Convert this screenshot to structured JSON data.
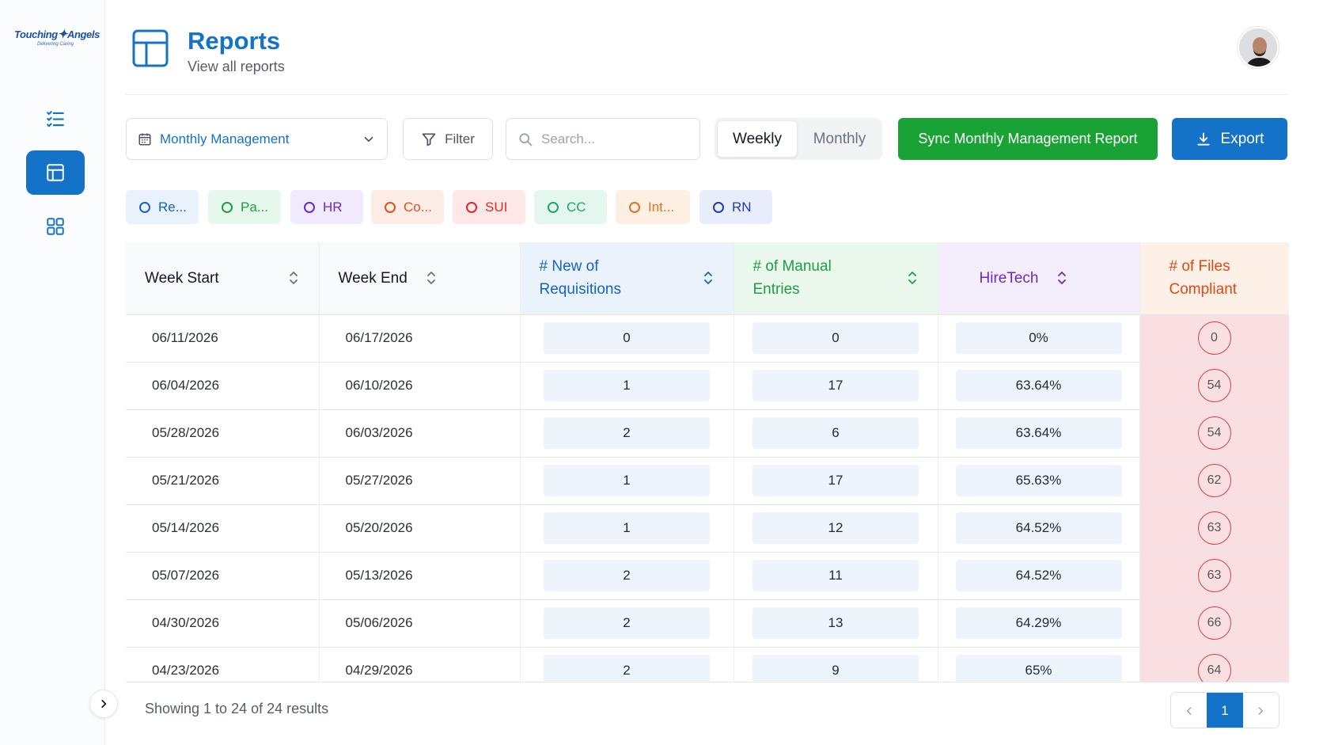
{
  "brand": {
    "logo_text": "Touching Angels",
    "logo_tagline": "Delivering Caring"
  },
  "header": {
    "title": "Reports",
    "subtitle": "View all reports"
  },
  "toolbar": {
    "report_select_value": "Monthly Management",
    "filter_label": "Filter",
    "search_placeholder": "Search...",
    "segments": [
      "Weekly",
      "Monthly"
    ],
    "active_segment": "Weekly",
    "sync_label": "Sync Monthly Management Report",
    "export_label": "Export"
  },
  "chips": [
    {
      "label": "Re...",
      "color": "#1565c0",
      "bg": "#e8f1fc"
    },
    {
      "label": "Pa...",
      "color": "#1e9e40",
      "bg": "#e6f7ec"
    },
    {
      "label": "HR",
      "color": "#6b2bc2",
      "bg": "#f1eafc"
    },
    {
      "label": "Co...",
      "color": "#d9541e",
      "bg": "#fdece5"
    },
    {
      "label": "SUI",
      "color": "#d92b2b",
      "bg": "#fde7e7"
    },
    {
      "label": "CC",
      "color": "#1ea36a",
      "bg": "#e4f7ef"
    },
    {
      "label": "Int...",
      "color": "#d9731e",
      "bg": "#fdf0e2"
    },
    {
      "label": "RN",
      "color": "#1f3ea8",
      "bg": "#e8edfb"
    }
  ],
  "table": {
    "columns": [
      {
        "label": "Week Start",
        "color": "#111827",
        "bg": "#f8f9fb",
        "sortable": true
      },
      {
        "label": "Week End",
        "color": "#111827",
        "bg": "#f8f9fb",
        "sortable": true
      },
      {
        "label": "# New of Requisitions",
        "color": "#1565c0",
        "bg": "#eaf2fc",
        "sortable": true
      },
      {
        "label": "# of Manual Entries",
        "color": "#1e9e40",
        "bg": "#eaf8ee",
        "sortable": true
      },
      {
        "label": "HireTech",
        "color": "#6b2bc2",
        "bg": "#f3edfc",
        "sortable": true
      },
      {
        "label": "# of Files Compliant",
        "color": "#d94a1a",
        "bg": "#fdf1e7",
        "sortable": false
      }
    ],
    "rows": [
      {
        "week_start": "06/11/2026",
        "week_end": "06/17/2026",
        "requisitions": "0",
        "manual_entries": "0",
        "hiretech": "0%",
        "files_compliant": "0"
      },
      {
        "week_start": "06/04/2026",
        "week_end": "06/10/2026",
        "requisitions": "1",
        "manual_entries": "17",
        "hiretech": "63.64%",
        "files_compliant": "54"
      },
      {
        "week_start": "05/28/2026",
        "week_end": "06/03/2026",
        "requisitions": "2",
        "manual_entries": "6",
        "hiretech": "63.64%",
        "files_compliant": "54"
      },
      {
        "week_start": "05/21/2026",
        "week_end": "05/27/2026",
        "requisitions": "1",
        "manual_entries": "17",
        "hiretech": "65.63%",
        "files_compliant": "62"
      },
      {
        "week_start": "05/14/2026",
        "week_end": "05/20/2026",
        "requisitions": "1",
        "manual_entries": "12",
        "hiretech": "64.52%",
        "files_compliant": "63"
      },
      {
        "week_start": "05/07/2026",
        "week_end": "05/13/2026",
        "requisitions": "2",
        "manual_entries": "11",
        "hiretech": "64.52%",
        "files_compliant": "63"
      },
      {
        "week_start": "04/30/2026",
        "week_end": "05/06/2026",
        "requisitions": "2",
        "manual_entries": "13",
        "hiretech": "64.29%",
        "files_compliant": "66"
      },
      {
        "week_start": "04/23/2026",
        "week_end": "04/29/2026",
        "requisitions": "2",
        "manual_entries": "9",
        "hiretech": "65%",
        "files_compliant": "64"
      }
    ]
  },
  "pagination": {
    "summary": "Showing 1 to 24 of 24 results",
    "current_page": "1"
  },
  "icons": {
    "sidebar": [
      "checklist-icon",
      "table-icon",
      "grid-icon"
    ],
    "header": "table-icon"
  }
}
